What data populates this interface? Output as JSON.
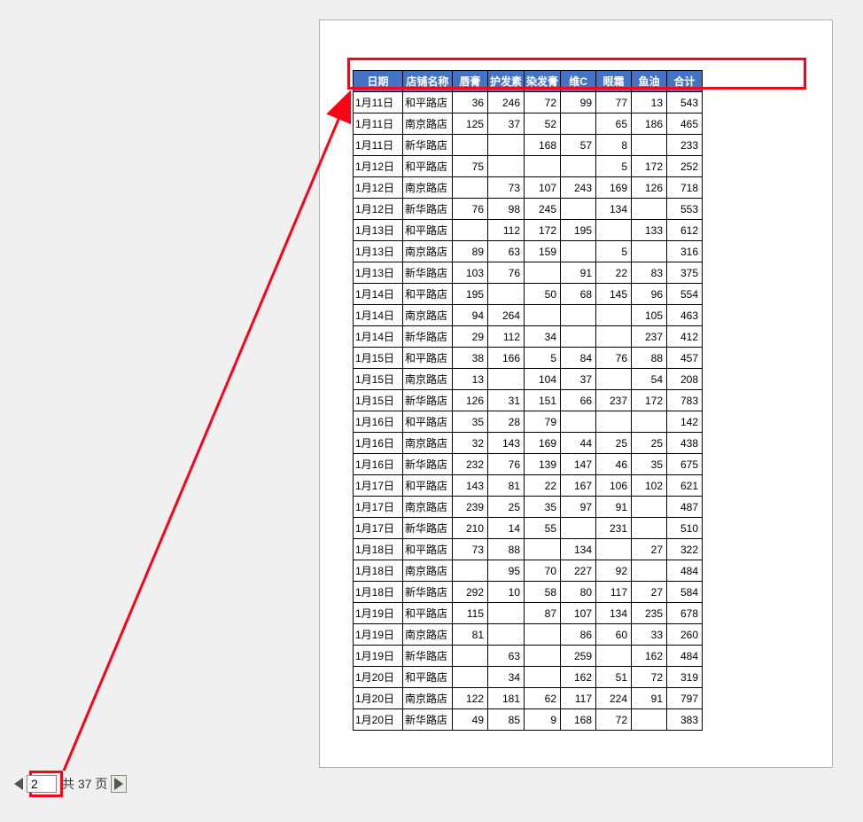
{
  "headers": [
    "日期",
    "店铺名称",
    "唇膏",
    "护发素",
    "染发膏",
    "维C",
    "眼霜",
    "鱼油",
    "合计"
  ],
  "rows": [
    {
      "date": "1月11日",
      "shop": "和平路店",
      "v": [
        "36",
        "246",
        "72",
        "99",
        "77",
        "13",
        "543"
      ]
    },
    {
      "date": "1月11日",
      "shop": "南京路店",
      "v": [
        "125",
        "37",
        "52",
        "",
        "65",
        "186",
        "465"
      ]
    },
    {
      "date": "1月11日",
      "shop": "新华路店",
      "v": [
        "",
        "",
        "168",
        "57",
        "8",
        "",
        "233"
      ]
    },
    {
      "date": "1月12日",
      "shop": "和平路店",
      "v": [
        "75",
        "",
        "",
        "",
        "5",
        "172",
        "252"
      ]
    },
    {
      "date": "1月12日",
      "shop": "南京路店",
      "v": [
        "",
        "73",
        "107",
        "243",
        "169",
        "126",
        "718"
      ]
    },
    {
      "date": "1月12日",
      "shop": "新华路店",
      "v": [
        "76",
        "98",
        "245",
        "",
        "134",
        "",
        "553"
      ]
    },
    {
      "date": "1月13日",
      "shop": "和平路店",
      "v": [
        "",
        "112",
        "172",
        "195",
        "",
        "133",
        "612"
      ]
    },
    {
      "date": "1月13日",
      "shop": "南京路店",
      "v": [
        "89",
        "63",
        "159",
        "",
        "5",
        "",
        "316"
      ]
    },
    {
      "date": "1月13日",
      "shop": "新华路店",
      "v": [
        "103",
        "76",
        "",
        "91",
        "22",
        "83",
        "375"
      ]
    },
    {
      "date": "1月14日",
      "shop": "和平路店",
      "v": [
        "195",
        "",
        "50",
        "68",
        "145",
        "96",
        "554"
      ]
    },
    {
      "date": "1月14日",
      "shop": "南京路店",
      "v": [
        "94",
        "264",
        "",
        "",
        "",
        "105",
        "463"
      ]
    },
    {
      "date": "1月14日",
      "shop": "新华路店",
      "v": [
        "29",
        "112",
        "34",
        "",
        "",
        "237",
        "412"
      ]
    },
    {
      "date": "1月15日",
      "shop": "和平路店",
      "v": [
        "38",
        "166",
        "5",
        "84",
        "76",
        "88",
        "457"
      ]
    },
    {
      "date": "1月15日",
      "shop": "南京路店",
      "v": [
        "13",
        "",
        "104",
        "37",
        "",
        "54",
        "208"
      ]
    },
    {
      "date": "1月15日",
      "shop": "新华路店",
      "v": [
        "126",
        "31",
        "151",
        "66",
        "237",
        "172",
        "783"
      ]
    },
    {
      "date": "1月16日",
      "shop": "和平路店",
      "v": [
        "35",
        "28",
        "79",
        "",
        "",
        "",
        "142"
      ]
    },
    {
      "date": "1月16日",
      "shop": "南京路店",
      "v": [
        "32",
        "143",
        "169",
        "44",
        "25",
        "25",
        "438"
      ]
    },
    {
      "date": "1月16日",
      "shop": "新华路店",
      "v": [
        "232",
        "76",
        "139",
        "147",
        "46",
        "35",
        "675"
      ]
    },
    {
      "date": "1月17日",
      "shop": "和平路店",
      "v": [
        "143",
        "81",
        "22",
        "167",
        "106",
        "102",
        "621"
      ]
    },
    {
      "date": "1月17日",
      "shop": "南京路店",
      "v": [
        "239",
        "25",
        "35",
        "97",
        "91",
        "",
        "487"
      ]
    },
    {
      "date": "1月17日",
      "shop": "新华路店",
      "v": [
        "210",
        "14",
        "55",
        "",
        "231",
        "",
        "510"
      ]
    },
    {
      "date": "1月18日",
      "shop": "和平路店",
      "v": [
        "73",
        "88",
        "",
        "134",
        "",
        "27",
        "322"
      ]
    },
    {
      "date": "1月18日",
      "shop": "南京路店",
      "v": [
        "",
        "95",
        "70",
        "227",
        "92",
        "",
        "484"
      ]
    },
    {
      "date": "1月18日",
      "shop": "新华路店",
      "v": [
        "292",
        "10",
        "58",
        "80",
        "117",
        "27",
        "584"
      ]
    },
    {
      "date": "1月19日",
      "shop": "和平路店",
      "v": [
        "115",
        "",
        "87",
        "107",
        "134",
        "235",
        "678"
      ]
    },
    {
      "date": "1月19日",
      "shop": "南京路店",
      "v": [
        "81",
        "",
        "",
        "86",
        "60",
        "33",
        "260"
      ]
    },
    {
      "date": "1月19日",
      "shop": "新华路店",
      "v": [
        "",
        "63",
        "",
        "259",
        "",
        "162",
        "484"
      ]
    },
    {
      "date": "1月20日",
      "shop": "和平路店",
      "v": [
        "",
        "34",
        "",
        "162",
        "51",
        "72",
        "319"
      ]
    },
    {
      "date": "1月20日",
      "shop": "南京路店",
      "v": [
        "122",
        "181",
        "62",
        "117",
        "224",
        "91",
        "797"
      ]
    },
    {
      "date": "1月20日",
      "shop": "新华路店",
      "v": [
        "49",
        "85",
        "9",
        "168",
        "72",
        "",
        "383"
      ]
    }
  ],
  "pager": {
    "current": "2",
    "total_prefix": "共 ",
    "total_pages": "37",
    "total_suffix": " 页"
  }
}
